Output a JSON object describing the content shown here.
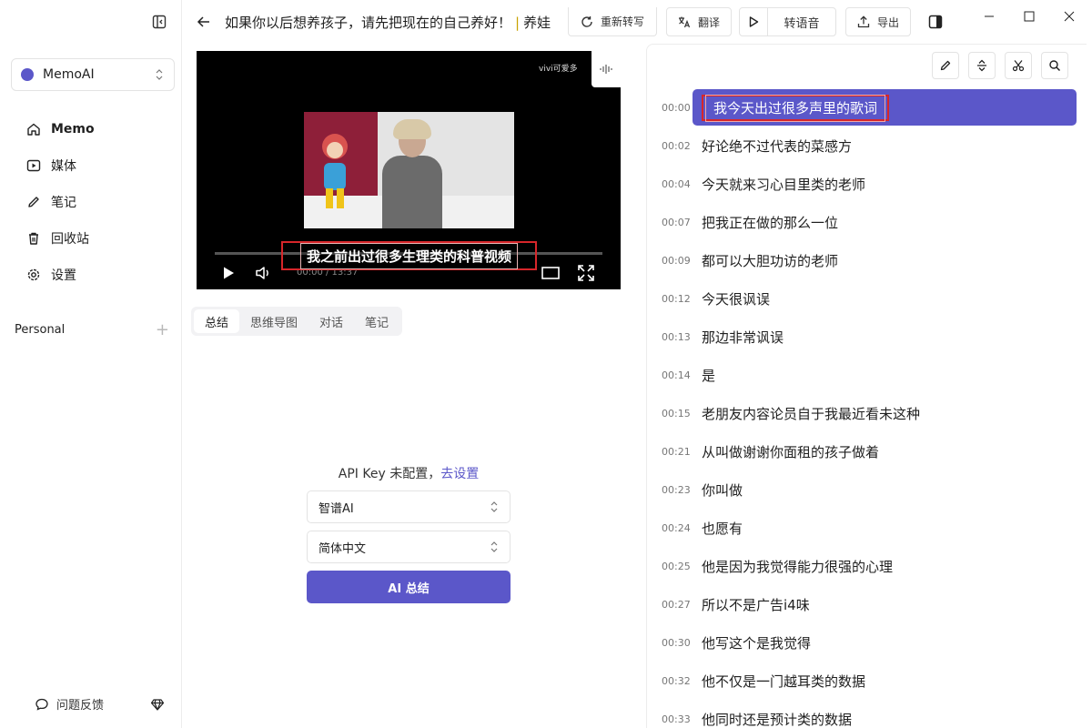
{
  "sidebar": {
    "workspace": "MemoAI",
    "nav": [
      {
        "label": "Memo",
        "icon": "home-icon"
      },
      {
        "label": "媒体",
        "icon": "play-square-icon"
      },
      {
        "label": "笔记",
        "icon": "pencil-icon"
      },
      {
        "label": "回收站",
        "icon": "trash-icon"
      },
      {
        "label": "设置",
        "icon": "gear-icon"
      }
    ],
    "section_label": "Personal",
    "section_add": "+",
    "feedback_label": "问题反馈"
  },
  "topbar": {
    "title_main": "如果你以后想养孩子，请先把现在的自己养好！",
    "title_sep": "|",
    "title_rest": "养娃",
    "retranscribe_label": "重新转写",
    "translate_label": "翻译",
    "to_speech_label": "转语音",
    "export_label": "导出"
  },
  "video": {
    "watermark": "vivi可爱多",
    "subtitle": "我之前出过很多生理类的科普视频",
    "timecode": "00:00 / 13:37",
    "progress": 0.0
  },
  "tabs": [
    {
      "label": "总结",
      "active": true
    },
    {
      "label": "思维导图",
      "active": false
    },
    {
      "label": "对话",
      "active": false
    },
    {
      "label": "笔记",
      "active": false
    }
  ],
  "api": {
    "message": "API Key 未配置，",
    "link": "去设置",
    "provider": "智谱AI",
    "language": "简体中文",
    "button": "AI 总结"
  },
  "transcript": [
    {
      "time": "00:00",
      "text": "我今天出过很多声里的歌词",
      "active": true
    },
    {
      "time": "00:02",
      "text": "好论绝不过代表的菜感方"
    },
    {
      "time": "00:04",
      "text": "今天就来习心目里类的老师"
    },
    {
      "time": "00:07",
      "text": "把我正在做的那么一位"
    },
    {
      "time": "00:09",
      "text": "都可以大胆功访的老师"
    },
    {
      "time": "00:12",
      "text": "今天很讽误"
    },
    {
      "time": "00:13",
      "text": "那边非常讽误"
    },
    {
      "time": "00:14",
      "text": "是"
    },
    {
      "time": "00:15",
      "text": "老朋友内容论员自于我最近看未这种"
    },
    {
      "time": "00:21",
      "text": "从叫做谢谢你面租的孩子做着"
    },
    {
      "time": "00:23",
      "text": "你叫做"
    },
    {
      "time": "00:24",
      "text": "也愿有"
    },
    {
      "time": "00:25",
      "text": "他是因为我觉得能力很强的心理"
    },
    {
      "time": "00:27",
      "text": "所以不是广告i4味"
    },
    {
      "time": "00:30",
      "text": "他写这个是我觉得"
    },
    {
      "time": "00:32",
      "text": "他不仅是一门越耳类的数据"
    },
    {
      "time": "00:33",
      "text": "他同时还是预计类的数据"
    }
  ],
  "colors": {
    "accent": "#5b57c9",
    "highlight_border": "#d7262a"
  }
}
